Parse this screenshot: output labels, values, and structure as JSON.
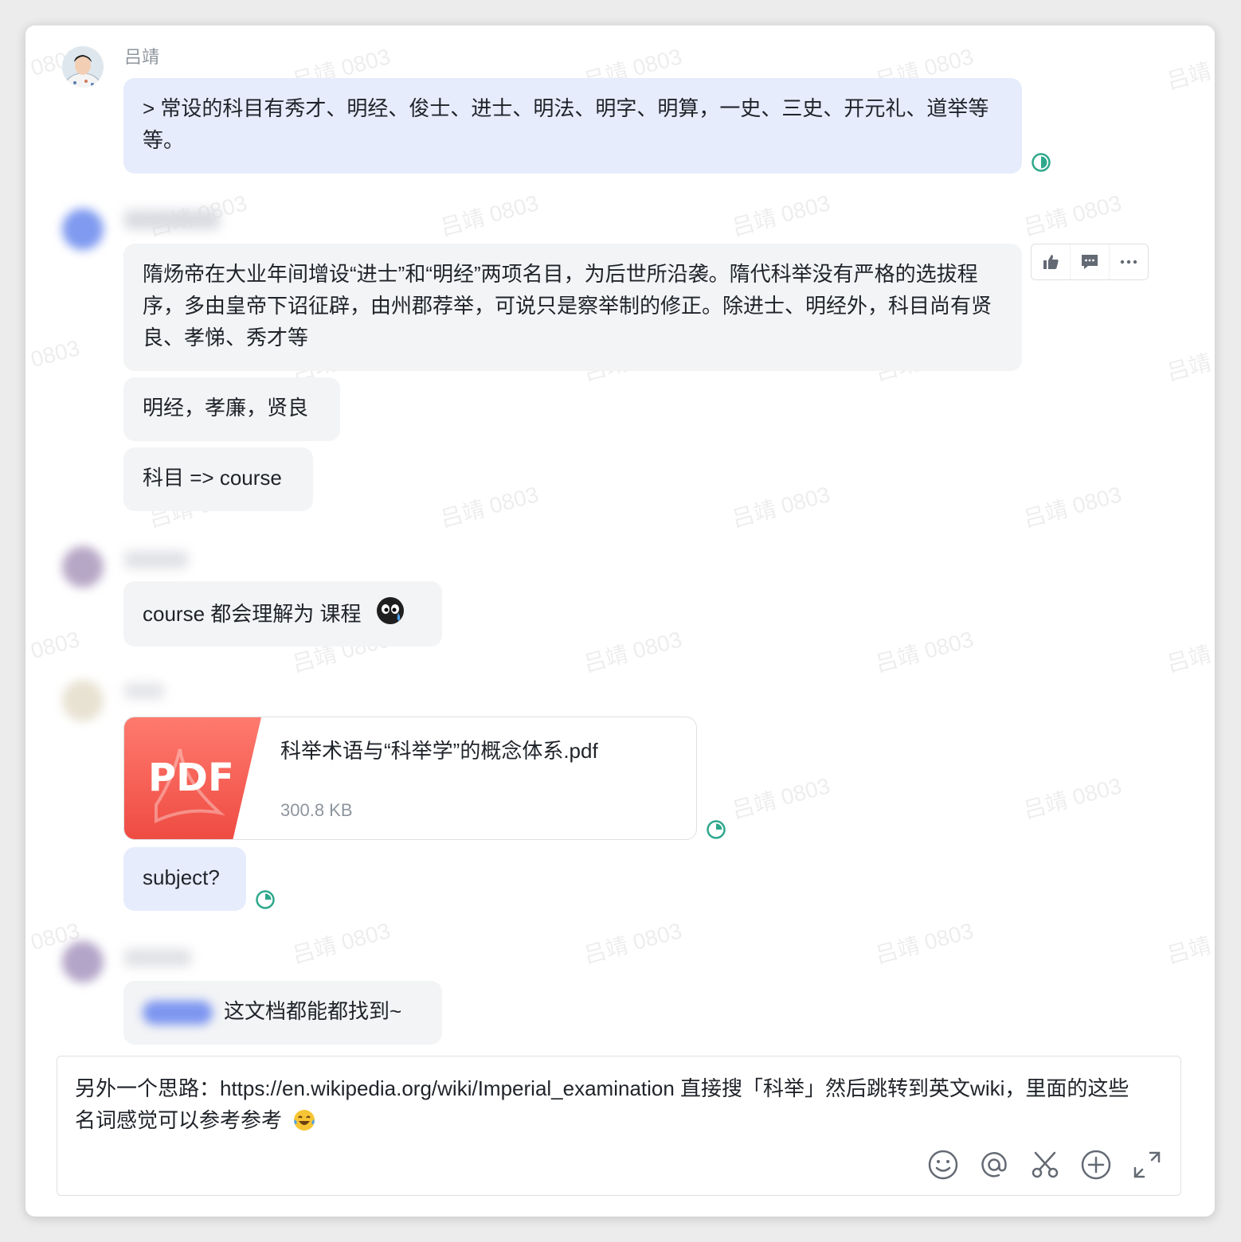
{
  "messages": [
    {
      "sender": "吕靖",
      "bubbles": [
        "> 常设的科目有秀才、明经、俊士、进士、明法、明字、明算，一史、三史、开元礼、道举等等。"
      ]
    },
    {
      "bubbles": [
        "隋炀帝在大业年间增设“进士”和“明经”两项名目，为后世所沿袭。隋代科举没有严格的选拔程序，多由皇帝下诏征辟，由州郡荐举，可说只是察举制的修正。除进士、明经外，科目尚有贤良、孝悌、秀才等",
        "明经，孝廉，贤良",
        "科目 => course"
      ]
    },
    {
      "bubbles": [
        "course 都会理解为 课程"
      ]
    },
    {
      "file": {
        "type_label": "PDF",
        "name": "科举术语与“科举学”的概念体系.pdf",
        "size": "300.8 KB"
      },
      "bubbles": [
        "subject?"
      ]
    },
    {
      "bubbles": [
        "这文档都能都找到~"
      ]
    }
  ],
  "watermark": "吕靖 0803",
  "composer": {
    "text": "另外一个思路：https://en.wikipedia.org/wiki/Imperial_examination 直接搜「科举」然后跳转到英文wiki，里面的这些名词感觉可以参考参考"
  },
  "icons": {
    "hover_toolbar": [
      "thumbs-up-icon",
      "reply-comment-icon",
      "more-icon"
    ],
    "composer_tools": [
      "emoji-icon",
      "mention-icon",
      "scissors-icon",
      "plus-circle-icon",
      "expand-icon"
    ]
  },
  "colors": {
    "my_bubble": "#e6ecfc",
    "other_bubble": "#f3f4f6",
    "status_green": "#2ea88c",
    "pdf_red": "#f04f45"
  }
}
